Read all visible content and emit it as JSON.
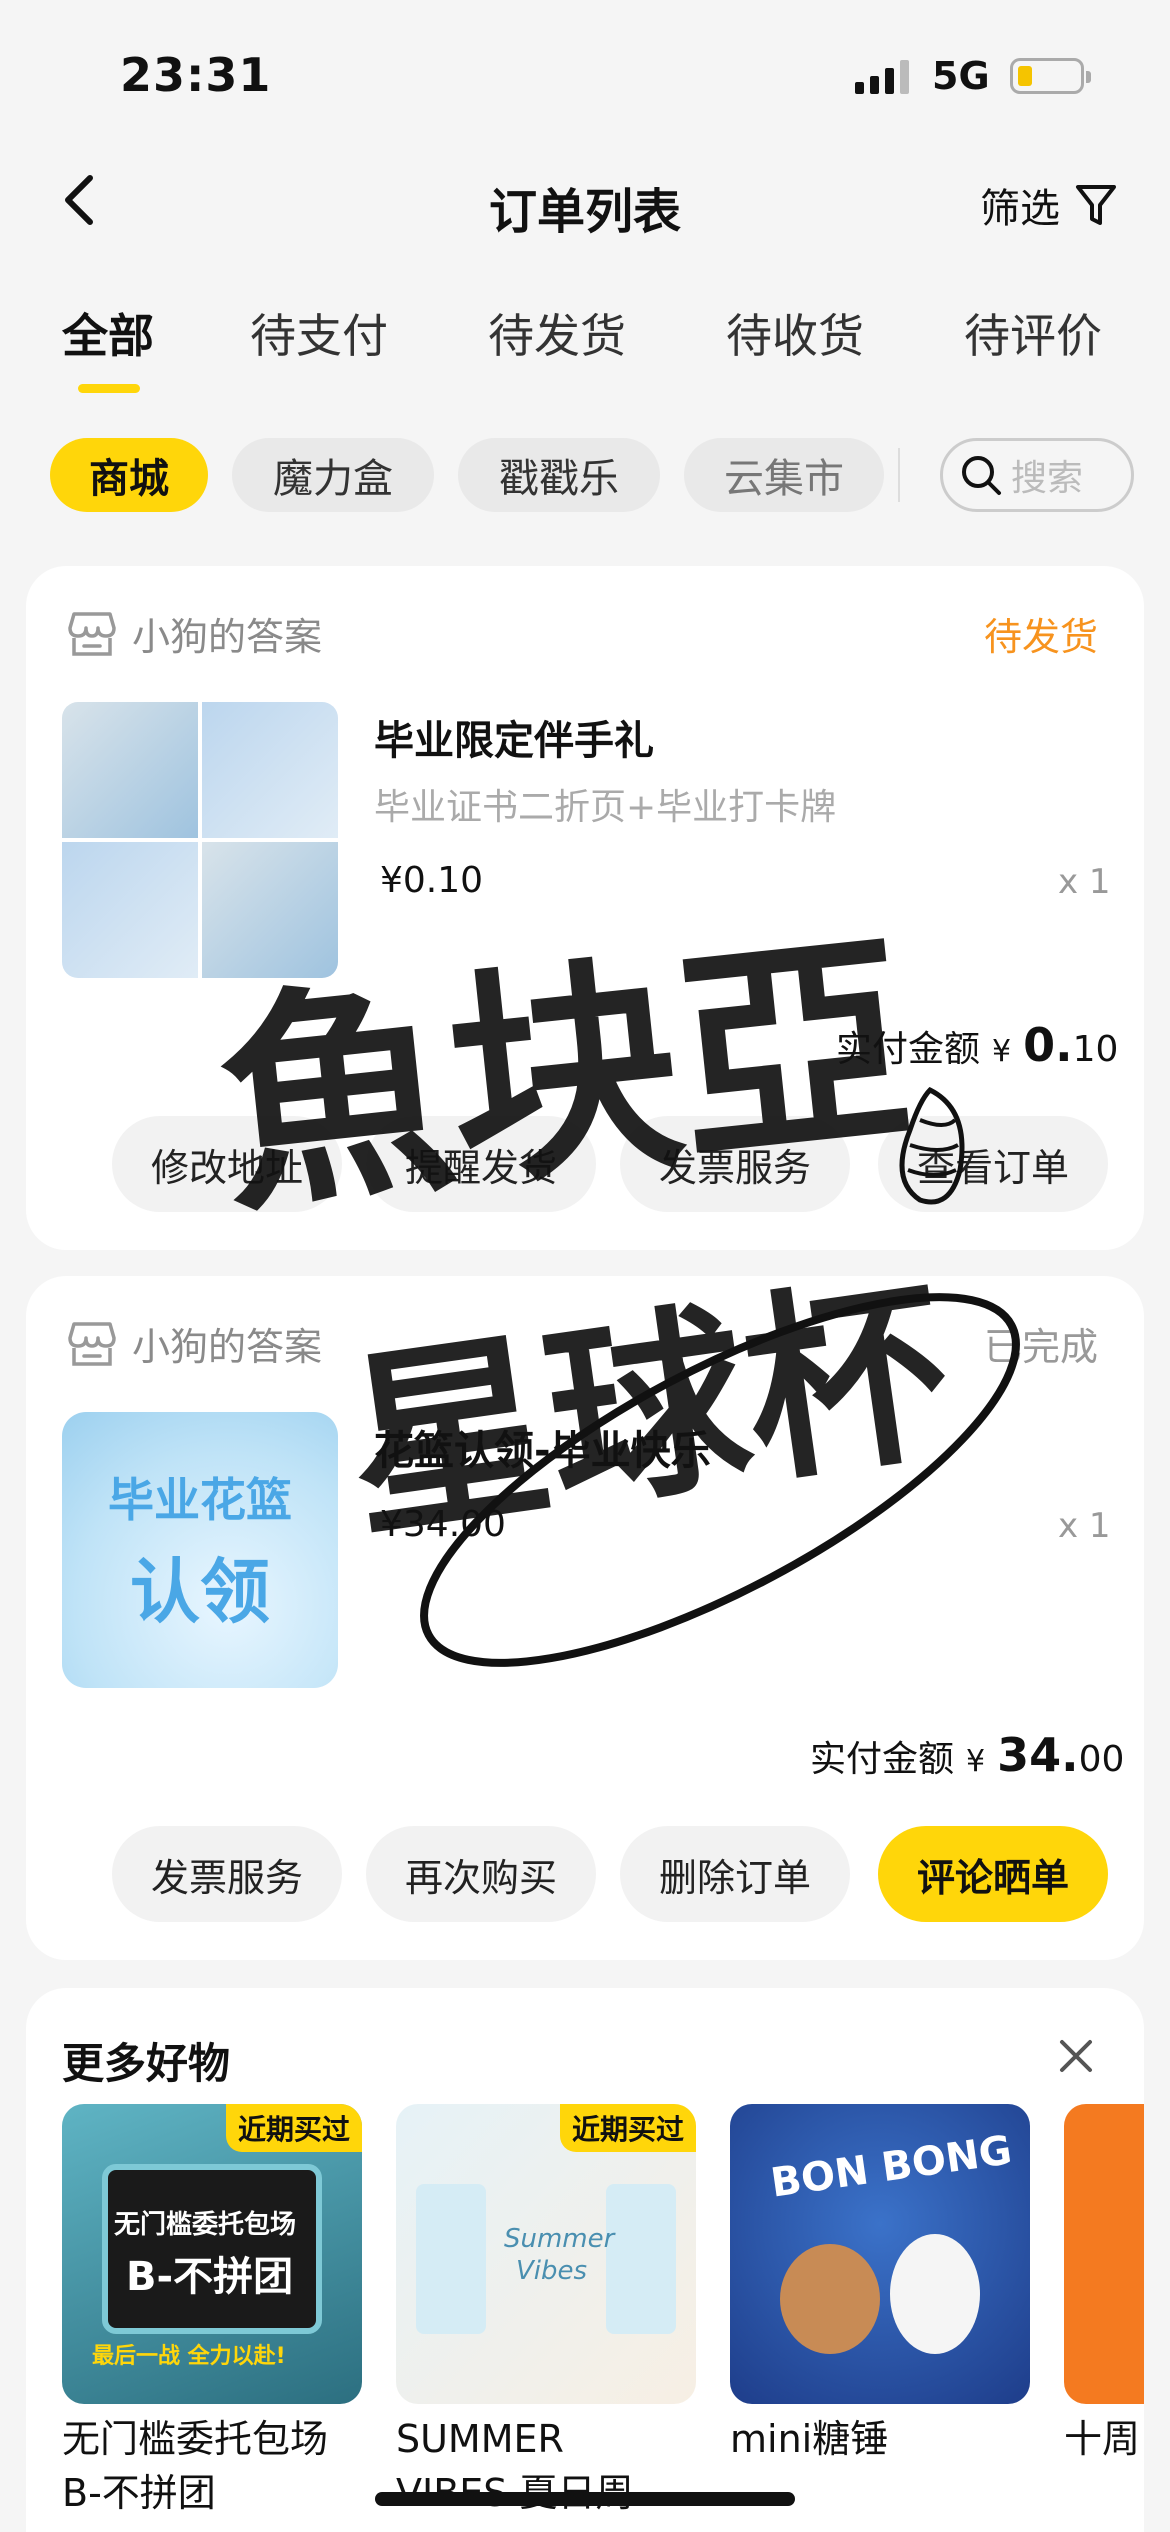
{
  "status_bar": {
    "time": "23:31",
    "network": "5G"
  },
  "nav": {
    "title": "订单列表",
    "filter_label": "筛选"
  },
  "tabs": [
    "全部",
    "待支付",
    "待发货",
    "待收货",
    "待评价"
  ],
  "chips": [
    "商城",
    "魔力盒",
    "戳戳乐",
    "云集市"
  ],
  "search": {
    "placeholder": "搜索"
  },
  "orders": [
    {
      "shop": "小狗的答案",
      "status": "待发货",
      "status_color": "#f7931e",
      "title": "毕业限定伴手礼",
      "subtitle": "毕业证书二折页+毕业打卡牌",
      "price": "¥0.10",
      "qty": "x 1",
      "paid_label": "实付金额",
      "paid_currency": "¥",
      "paid_int": "0.",
      "paid_dec": "10",
      "buttons": [
        "修改地址",
        "提醒发货",
        "发票服务",
        "查看订单"
      ]
    },
    {
      "shop": "小狗的答案",
      "status": "已完成",
      "status_color": "#999999",
      "title": "花篮认领-毕业快乐",
      "price": "¥34.00",
      "qty": "x 1",
      "thumb_text": [
        "毕业花篮",
        "认领"
      ],
      "paid_label": "实付金额",
      "paid_currency": "¥",
      "paid_int": "34.",
      "paid_dec": "00",
      "buttons": [
        "发票服务",
        "再次购买",
        "删除订单",
        "评论晒单"
      ]
    }
  ],
  "recommend": {
    "title": "更多好物",
    "items": [
      {
        "name_line1": "无门槛委托包场",
        "name_line2": "B-不拼团",
        "tag": "近期买过",
        "art": [
          "无门槛委托包场",
          "B-不拼团",
          "最后一战 全力以赴!"
        ]
      },
      {
        "name_line1": "SUMMER",
        "name_line2": "VIBES 夏日周...",
        "tag": "近期买过",
        "art": [
          "Summer",
          "Vibes"
        ]
      },
      {
        "name_line1": "mini糖锤",
        "name_line2": "",
        "tag": "",
        "art": [
          "BON BONG"
        ]
      },
      {
        "name_line1": "十周",
        "name_line2": "",
        "tag": "",
        "art": []
      }
    ]
  },
  "overlay_text": [
    "魚块亞",
    "星球杯"
  ]
}
